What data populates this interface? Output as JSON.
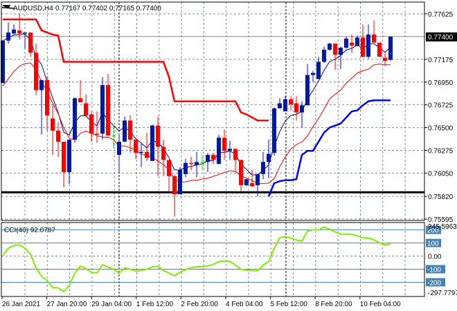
{
  "header": {
    "symbol": "AUDUSD,H4",
    "ohlc": "0.77167 0.77402 0.77165 0.77400",
    "icon": "sell-arrow-icon"
  },
  "colors": {
    "bull_body": "#0018a8",
    "bull_wick": "#0000ff",
    "bear": "#ff0000",
    "doji": "#00e000",
    "ma_fast": "#000080",
    "ma_slow": "#ff0000",
    "step_upper": "#ff0000",
    "step_lower": "#0000ff",
    "cci": "#80ee00",
    "cci_level": "#4682b4",
    "grid": "#778899"
  },
  "price_axis": {
    "labels": [
      "0.77625",
      "0.77175",
      "0.76950",
      "0.76725",
      "0.76500",
      "0.76275",
      "0.76050",
      "0.75820",
      "0.75595"
    ],
    "current_price": "0.77400",
    "min": 0.75595,
    "max": 0.77625
  },
  "support_level": 0.7586,
  "cci": {
    "label": "CCI(40) 92.0787",
    "max_label": "245.5963",
    "min_label": "-297.7797",
    "max": 245.5963,
    "min": -297.7797,
    "levels": [
      "200",
      "100",
      "-100",
      "-200"
    ],
    "zero_label": "0.00",
    "values": [
      5,
      60,
      80,
      86,
      60,
      14,
      -90,
      -155,
      -186,
      -242,
      -242,
      -272,
      -225,
      -130,
      -77,
      -95,
      -125,
      -128,
      -65,
      -85,
      -100,
      -130,
      -90,
      -100,
      -115,
      -110,
      -100,
      -82,
      -78,
      -110,
      -130,
      -150,
      -125,
      -103,
      -88,
      -82,
      -81,
      -75,
      -63,
      -42,
      -37,
      -40,
      -70,
      -100,
      -108,
      -111,
      -111,
      -70,
      -40,
      60,
      140,
      150,
      138,
      122,
      116,
      190,
      200,
      200,
      222,
      205,
      185,
      168,
      167,
      165,
      153,
      140,
      138,
      125,
      100,
      86,
      92
    ]
  },
  "time_axis": [
    "26 Jan 2021",
    "27 Jan 20:00",
    "29 Jan 04:00",
    "1 Feb 12:00",
    "2 Feb 20:00",
    "4 Feb 04:00",
    "5 Feb 12:00",
    "8 Feb 20:00",
    "10 Feb 04:00"
  ],
  "chart_data": {
    "type": "candlestick",
    "title": "AUDUSD,H4",
    "candles": [
      [
        0.7694,
        0.7736,
        0.7694,
        0.7736
      ],
      [
        0.7736,
        0.7754,
        0.7733,
        0.7744
      ],
      [
        0.7743,
        0.7752,
        0.7742,
        0.7747
      ],
      [
        0.7746,
        0.7762,
        0.7737,
        0.7743
      ],
      [
        0.7743,
        0.7744,
        0.7728,
        0.7744
      ],
      [
        0.7744,
        0.7744,
        0.772,
        0.7724
      ],
      [
        0.7724,
        0.7733,
        0.7682,
        0.7687
      ],
      [
        0.7687,
        0.7697,
        0.7643,
        0.7697
      ],
      [
        0.7697,
        0.7701,
        0.7647,
        0.7662
      ],
      [
        0.7659,
        0.7672,
        0.7623,
        0.7647
      ],
      [
        0.7647,
        0.7655,
        0.7621,
        0.7636
      ],
      [
        0.7636,
        0.7636,
        0.7591,
        0.7606
      ],
      [
        0.7606,
        0.7638,
        0.7594,
        0.7638
      ],
      [
        0.7638,
        0.768,
        0.7635,
        0.7679
      ],
      [
        0.7679,
        0.7697,
        0.7675,
        0.7675
      ],
      [
        0.7674,
        0.7683,
        0.7661,
        0.7662
      ],
      [
        0.7663,
        0.7666,
        0.7636,
        0.7644
      ],
      [
        0.7644,
        0.7666,
        0.7635,
        0.7643
      ],
      [
        0.7644,
        0.77,
        0.7638,
        0.7692
      ],
      [
        0.7692,
        0.7703,
        0.7642,
        0.7642
      ],
      [
        0.7642,
        0.7653,
        0.763,
        0.7642
      ],
      [
        0.7623,
        0.7644,
        0.7606,
        0.7636
      ],
      [
        0.7636,
        0.7661,
        0.7636,
        0.7657
      ],
      [
        0.7657,
        0.7662,
        0.7625,
        0.7638
      ],
      [
        0.7638,
        0.7638,
        0.7619,
        0.7625
      ],
      [
        0.7625,
        0.7634,
        0.7611,
        0.7626
      ],
      [
        0.7626,
        0.7645,
        0.7617,
        0.762
      ],
      [
        0.7617,
        0.7653,
        0.7617,
        0.7652
      ],
      [
        0.7652,
        0.7661,
        0.7602,
        0.7631
      ],
      [
        0.7631,
        0.7638,
        0.7602,
        0.7618
      ],
      [
        0.7618,
        0.7618,
        0.7587,
        0.7602
      ],
      [
        0.7602,
        0.7603,
        0.7562,
        0.7584
      ],
      [
        0.7584,
        0.7611,
        0.7584,
        0.7608
      ],
      [
        0.7604,
        0.7619,
        0.7601,
        0.7615
      ],
      [
        0.7615,
        0.7621,
        0.7608,
        0.7614
      ],
      [
        0.7613,
        0.7626,
        0.7601,
        0.7616
      ],
      [
        0.7616,
        0.7623,
        0.7608,
        0.7616
      ],
      [
        0.7616,
        0.7625,
        0.7606,
        0.7623
      ],
      [
        0.7623,
        0.7625,
        0.7614,
        0.7618
      ],
      [
        0.7614,
        0.7643,
        0.7614,
        0.764
      ],
      [
        0.764,
        0.7648,
        0.7618,
        0.7627
      ],
      [
        0.7627,
        0.7637,
        0.7618,
        0.7629
      ],
      [
        0.7629,
        0.7629,
        0.7606,
        0.7618
      ],
      [
        0.7618,
        0.7618,
        0.7587,
        0.7593
      ],
      [
        0.7593,
        0.7599,
        0.7592,
        0.7599
      ],
      [
        0.7595,
        0.7608,
        0.7591,
        0.7592
      ],
      [
        0.7593,
        0.7604,
        0.7582,
        0.7604
      ],
      [
        0.7604,
        0.7626,
        0.7599,
        0.7616
      ],
      [
        0.7616,
        0.7638,
        0.76,
        0.7624
      ],
      [
        0.7625,
        0.767,
        0.7622,
        0.7669
      ],
      [
        0.7669,
        0.7679,
        0.7669,
        0.7674
      ],
      [
        0.7666,
        0.7681,
        0.7666,
        0.7678
      ],
      [
        0.7678,
        0.7681,
        0.7667,
        0.7673
      ],
      [
        0.7674,
        0.7681,
        0.7657,
        0.7665
      ],
      [
        0.7665,
        0.7676,
        0.765,
        0.7672
      ],
      [
        0.7672,
        0.7713,
        0.7672,
        0.7702
      ],
      [
        0.7702,
        0.7706,
        0.7695,
        0.7704
      ],
      [
        0.7698,
        0.772,
        0.7698,
        0.7715
      ],
      [
        0.7715,
        0.773,
        0.7714,
        0.7727
      ],
      [
        0.7727,
        0.7734,
        0.7726,
        0.7733
      ],
      [
        0.7733,
        0.7733,
        0.7707,
        0.7722
      ],
      [
        0.7722,
        0.773,
        0.7708,
        0.7729
      ],
      [
        0.7729,
        0.774,
        0.7728,
        0.7738
      ],
      [
        0.7734,
        0.7742,
        0.7724,
        0.7731
      ],
      [
        0.7731,
        0.7741,
        0.773,
        0.7739
      ],
      [
        0.7739,
        0.7752,
        0.7719,
        0.772
      ],
      [
        0.772,
        0.7752,
        0.7718,
        0.7742
      ],
      [
        0.7742,
        0.7756,
        0.7734,
        0.7734
      ],
      [
        0.7734,
        0.7734,
        0.772,
        0.772
      ],
      [
        0.7719,
        0.7724,
        0.7711,
        0.7716
      ],
      [
        0.7717,
        0.774,
        0.7716,
        0.774
      ]
    ],
    "step_upper": [
      0.7757,
      0.7757,
      0.7757,
      0.7757,
      0.7757,
      0.7757,
      0.7757,
      0.7746,
      0.7744,
      0.7742,
      0.7741,
      0.7715,
      0.7715,
      0.7715,
      0.7715,
      0.7715,
      0.7715,
      0.7715,
      0.7715,
      0.7715,
      0.7715,
      0.7715,
      0.7715,
      0.7715,
      0.7715,
      0.7715,
      0.7715,
      0.7715,
      0.7715,
      0.7715,
      0.77,
      0.7676,
      0.7676,
      0.7676,
      0.7676,
      0.7676,
      0.7676,
      0.7676,
      0.7676,
      0.7676,
      0.7676,
      0.7676,
      0.7676,
      0.7665,
      0.7663,
      0.766,
      0.7657,
      0.7657,
      0.7657,
      null,
      null,
      null,
      null,
      null,
      null,
      null,
      null,
      null,
      null,
      null,
      null,
      null,
      null,
      null,
      null,
      null,
      null,
      null,
      null,
      null,
      null
    ],
    "step_lower": [
      null,
      null,
      null,
      null,
      null,
      null,
      null,
      null,
      null,
      null,
      null,
      null,
      null,
      null,
      null,
      null,
      null,
      null,
      null,
      null,
      null,
      null,
      null,
      null,
      null,
      null,
      null,
      null,
      null,
      null,
      null,
      null,
      null,
      null,
      null,
      null,
      null,
      null,
      null,
      null,
      null,
      null,
      null,
      null,
      null,
      null,
      null,
      null,
      0.7582,
      0.7595,
      0.7597,
      0.7598,
      0.7598,
      0.7599,
      0.7623,
      0.7627,
      0.7627,
      0.7636,
      0.7645,
      0.765,
      0.7652,
      0.7654,
      0.766,
      0.7666,
      0.7667,
      0.7672,
      0.7676,
      0.7677,
      0.7677,
      0.7677,
      0.7677
    ]
  }
}
